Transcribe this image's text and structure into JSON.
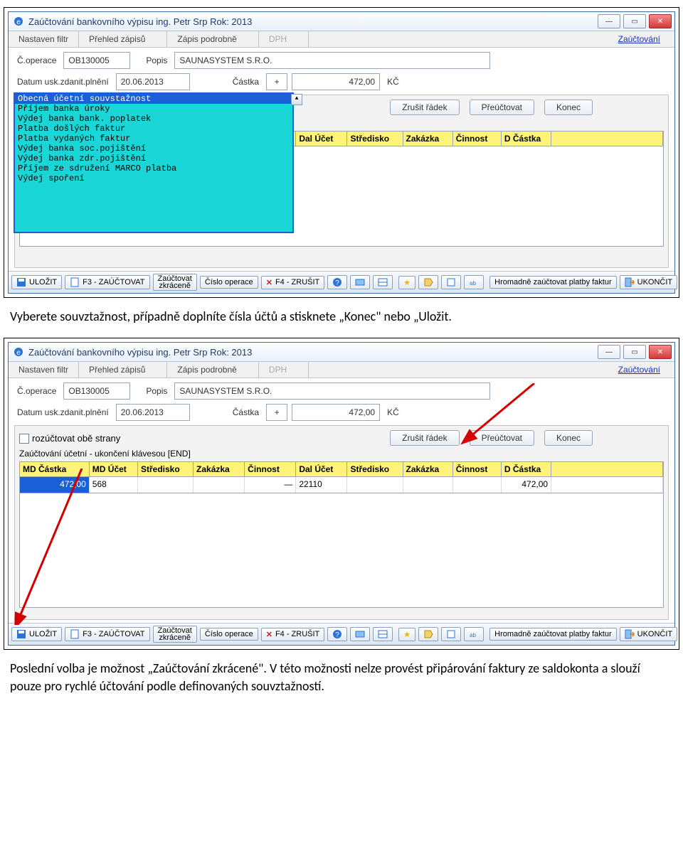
{
  "doc": {
    "caption1": "Vyberete souvztažnost, případně doplníte čísla účtů a stisknete „Konec\" nebo „Uložit.",
    "caption2": "Poslední volba je možnost „Zaúčtování zkrácené\". V této možnosti nelze provést připárování faktury ze saldokonta a slouží pouze pro rychlé účtování podle definovaných souvztažností."
  },
  "win": {
    "title": "Zaúčtování bankovního výpisu  ing. Petr Srp  Rok: 2013",
    "tabs": {
      "t0": "Nastaven filtr",
      "t1": "Přehled zápisů",
      "t2": "Zápis podrobně",
      "t3": "DPH",
      "link": "Zaúčtování"
    },
    "form": {
      "coperace_lbl": "Č.operace",
      "coperace": "OB130005",
      "popis_lbl": "Popis",
      "popis": "SAUNASYSTEM S.R.O.",
      "datum_lbl": "Datum usk.zdanit.plnění",
      "datum": "20.06.2013",
      "castka_lbl": "Částka",
      "sign": "+",
      "castka": "472,00",
      "mena": "KČ"
    },
    "mid": {
      "chk": "rozúčtovat obě strany",
      "hint": "Zaúčtování účetní - ukončení klávesou [END]",
      "btn_zrusit": "Zrušit řádek",
      "btn_preuct": "Přeúčtovat",
      "btn_konec": "Konec",
      "hdr": {
        "c0": "MD Částka",
        "c1": "MD Účet",
        "c2": "Středisko",
        "c3": "Zakázka",
        "c4": "Činnost",
        "c5": "Dal Účet",
        "c6": "Středisko",
        "c7": "Zakázka",
        "c8": "Činnost",
        "c9": "D Částka"
      },
      "row1": {
        "md_castka": "472,00",
        "md_ucet": "568",
        "dal_ucet": "22110",
        "d_castka": "472,00"
      }
    },
    "list": {
      "i0": "Obecná účetní souvstažnost",
      "i1": "Příjem banka úroky",
      "i2": "Výdej  banka bank. poplatek",
      "i3": "Platba došlých faktur",
      "i4": "Platba vydaných faktur",
      "i5": "Výdej banka soc.pojištění",
      "i6": "Výdej banka zdr.pojištění",
      "i7": "Příjem ze sdružení MARCO platba",
      "i8": "Výdej spoření"
    },
    "bbar": {
      "ulozit": "ULOŽIT",
      "f3": "F3 - ZAÚČTOVAT",
      "zkr1": "Zaúčtovat",
      "zkr2": "zkráceně",
      "cop": "Číslo operace",
      "f4": "F4 - ZRUŠIT",
      "hrom": "Hromadně zaúčtovat platby faktur",
      "ukoncit": "UKONČIT"
    }
  }
}
